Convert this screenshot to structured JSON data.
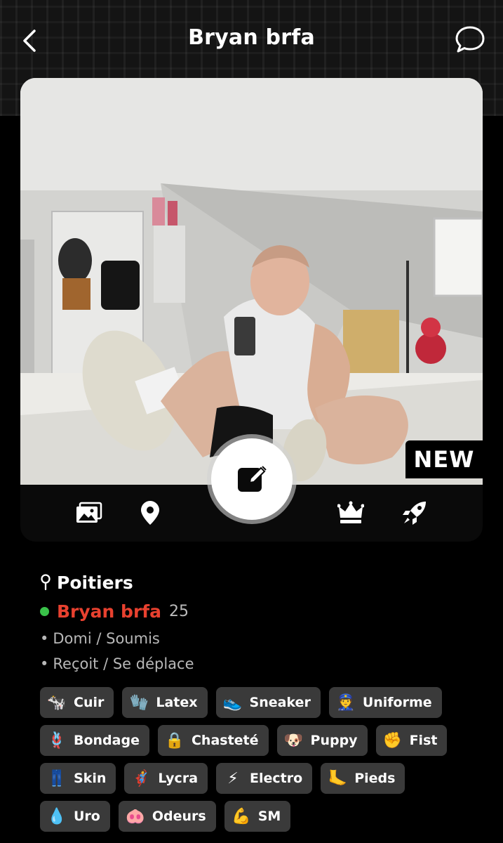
{
  "header": {
    "title": "Bryan brfa"
  },
  "badge": {
    "new_label": "NEW"
  },
  "profile": {
    "city": "Poitiers",
    "name": "Bryan brfa",
    "age": "25",
    "status": "online",
    "roles": [
      "Domi / Soumis",
      "Reçoit / Se déplace"
    ]
  },
  "tags": [
    [
      {
        "icon": "leather-icon",
        "glyph": "🐄",
        "label": "Cuir"
      },
      {
        "icon": "glove-icon",
        "glyph": "🧤",
        "label": "Latex"
      },
      {
        "icon": "sneaker-icon",
        "glyph": "👟",
        "label": "Sneaker"
      },
      {
        "icon": "police-officer-icon",
        "glyph": "👮",
        "label": "Uniforme"
      }
    ],
    [
      {
        "icon": "rope-icon",
        "glyph": "🪢",
        "label": "Bondage"
      },
      {
        "icon": "lock-icon",
        "glyph": "🔒",
        "label": "Chasteté"
      },
      {
        "icon": "puppy-mask-icon",
        "glyph": "🐶",
        "label": "Puppy"
      },
      {
        "icon": "fist-icon",
        "glyph": "✊",
        "label": "Fist"
      }
    ],
    [
      {
        "icon": "jeans-icon",
        "glyph": "👖",
        "label": "Skin"
      },
      {
        "icon": "superhero-icon",
        "glyph": "🦸",
        "label": "Lycra"
      },
      {
        "icon": "lightning-icon",
        "glyph": "⚡",
        "label": "Electro"
      },
      {
        "icon": "foot-icon",
        "glyph": "🦶",
        "label": "Pieds"
      }
    ],
    [
      {
        "icon": "droplet-icon",
        "glyph": "💧",
        "label": "Uro"
      },
      {
        "icon": "pig-nose-icon",
        "glyph": "🐽",
        "label": "Odeurs"
      },
      {
        "icon": "flexed-biceps-icon",
        "glyph": "💪",
        "label": "SM"
      }
    ]
  ],
  "colors": {
    "name": "#e8412f",
    "online": "#3ac24a",
    "tag_bg": "#3a3a3a",
    "background": "#000000"
  }
}
